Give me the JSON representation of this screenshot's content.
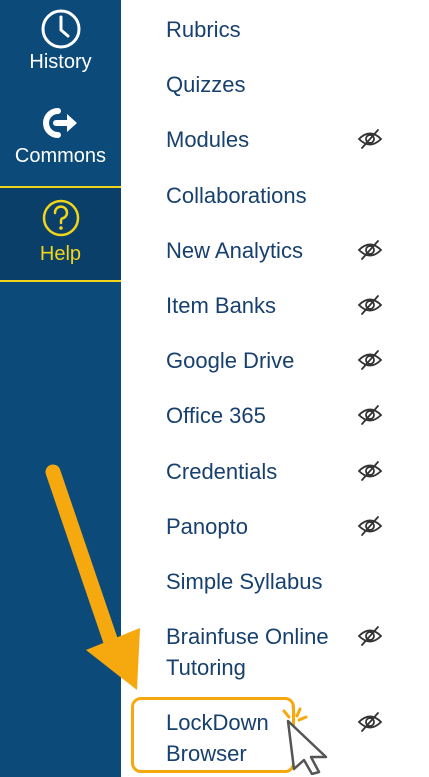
{
  "global_nav": {
    "items": [
      {
        "label": "History",
        "icon": "clock-icon"
      },
      {
        "label": "Commons",
        "icon": "commons-arrow-icon"
      },
      {
        "label": "Help",
        "icon": "help-circle-icon",
        "active": true
      }
    ]
  },
  "course_nav": {
    "items": [
      {
        "label": "Rubrics",
        "hidden": false
      },
      {
        "label": "Quizzes",
        "hidden": false
      },
      {
        "label": "Modules",
        "hidden": true
      },
      {
        "label": "Collaborations",
        "hidden": false
      },
      {
        "label": "New Analytics",
        "hidden": true
      },
      {
        "label": "Item Banks",
        "hidden": true
      },
      {
        "label": "Google Drive",
        "hidden": true
      },
      {
        "label": "Office 365",
        "hidden": true
      },
      {
        "label": "Credentials",
        "hidden": true
      },
      {
        "label": "Panopto",
        "hidden": true
      },
      {
        "label": "Simple Syllabus",
        "hidden": false
      },
      {
        "label": "Brainfuse Online Tutoring",
        "hidden": true
      },
      {
        "label": "LockDown Browser",
        "hidden": true
      }
    ]
  },
  "colors": {
    "nav_bg": "#0c4a7a",
    "link": "#17406e",
    "help_accent": "#f2d51a",
    "annotation": "#f6a90f"
  },
  "annotation": {
    "arrow": "arrow-annotation",
    "highlight": "highlight-box",
    "cursor": "click-cursor-icon"
  }
}
